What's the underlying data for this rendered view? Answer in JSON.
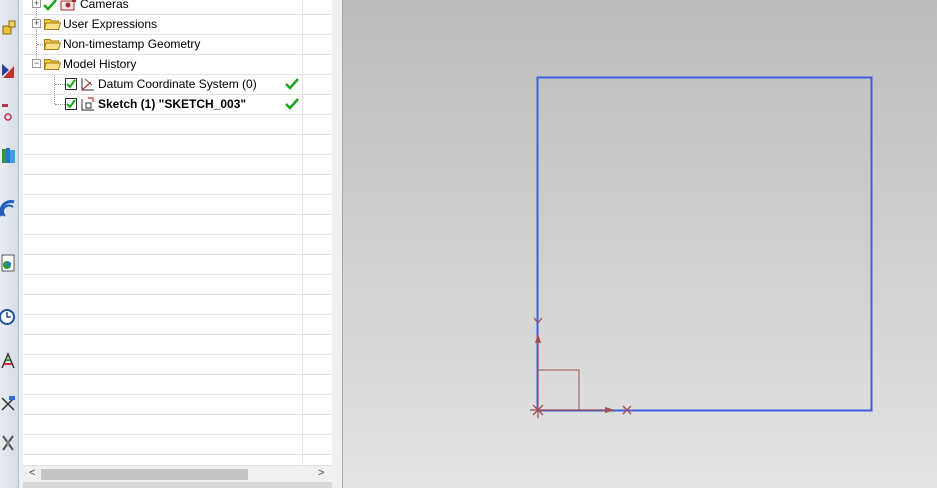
{
  "navigator": {
    "rows": [
      {
        "label": "Cameras",
        "bold": false
      },
      {
        "label": "User Expressions",
        "bold": false
      },
      {
        "label": "Non-timestamp Geometry",
        "bold": false
      },
      {
        "label": "Model History",
        "bold": false
      },
      {
        "label": "Datum Coordinate System (0)",
        "bold": false,
        "status": "check"
      },
      {
        "label": "Sketch (1) \"SKETCH_003\"",
        "bold": true,
        "status": "check"
      }
    ]
  },
  "scrollbar": {
    "left_arrow": "<",
    "right_arrow": ">"
  },
  "colors": {
    "sketch_curve": "#3d5fe0",
    "constraint": "#a05050",
    "check_green": "#1aa51a"
  },
  "resource_bar_icons": [
    "assembly-navigator-icon",
    "constraint-navigator-icon",
    "part-navigator-icon",
    "reuse-library-icon",
    "web-browser-icon",
    "roles-icon",
    "history-icon",
    "system-materials-icon",
    "process-studio-icon",
    "manufacturing-wizard-icon"
  ]
}
